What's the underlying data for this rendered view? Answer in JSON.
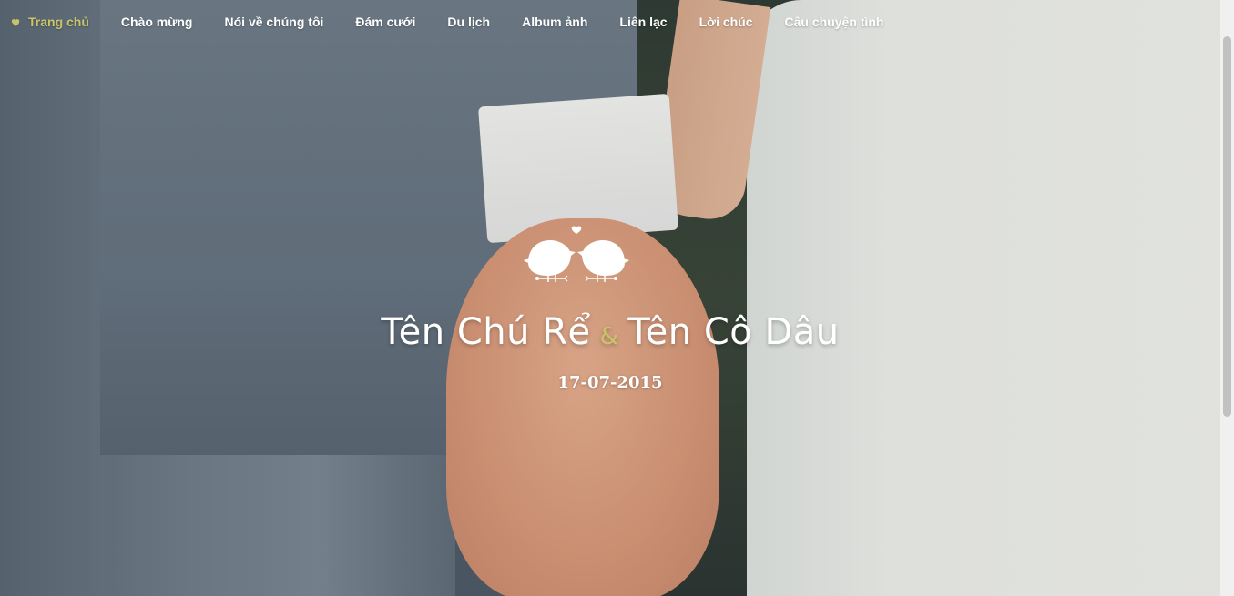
{
  "nav": {
    "items": [
      {
        "label": "Trang chủ",
        "active": true,
        "icon": "heart-icon"
      },
      {
        "label": "Chào mừng",
        "active": false
      },
      {
        "label": "Nói về chúng tôi",
        "active": false
      },
      {
        "label": "Đám cưới",
        "active": false
      },
      {
        "label": "Du lịch",
        "active": false
      },
      {
        "label": "Album ảnh",
        "active": false
      },
      {
        "label": "Liên lạc",
        "active": false
      },
      {
        "label": "Lời chúc",
        "active": false
      },
      {
        "label": "Câu chuyện tình",
        "active": false
      }
    ],
    "active_color": "#c9c46a",
    "text_color": "#ffffff"
  },
  "hero": {
    "emblem_icon": "kissing-birds-icon",
    "groom_name": "Tên Chú Rể",
    "separator": "&",
    "bride_name": "Tên Cô Dâu",
    "date": "17-07-2015"
  }
}
